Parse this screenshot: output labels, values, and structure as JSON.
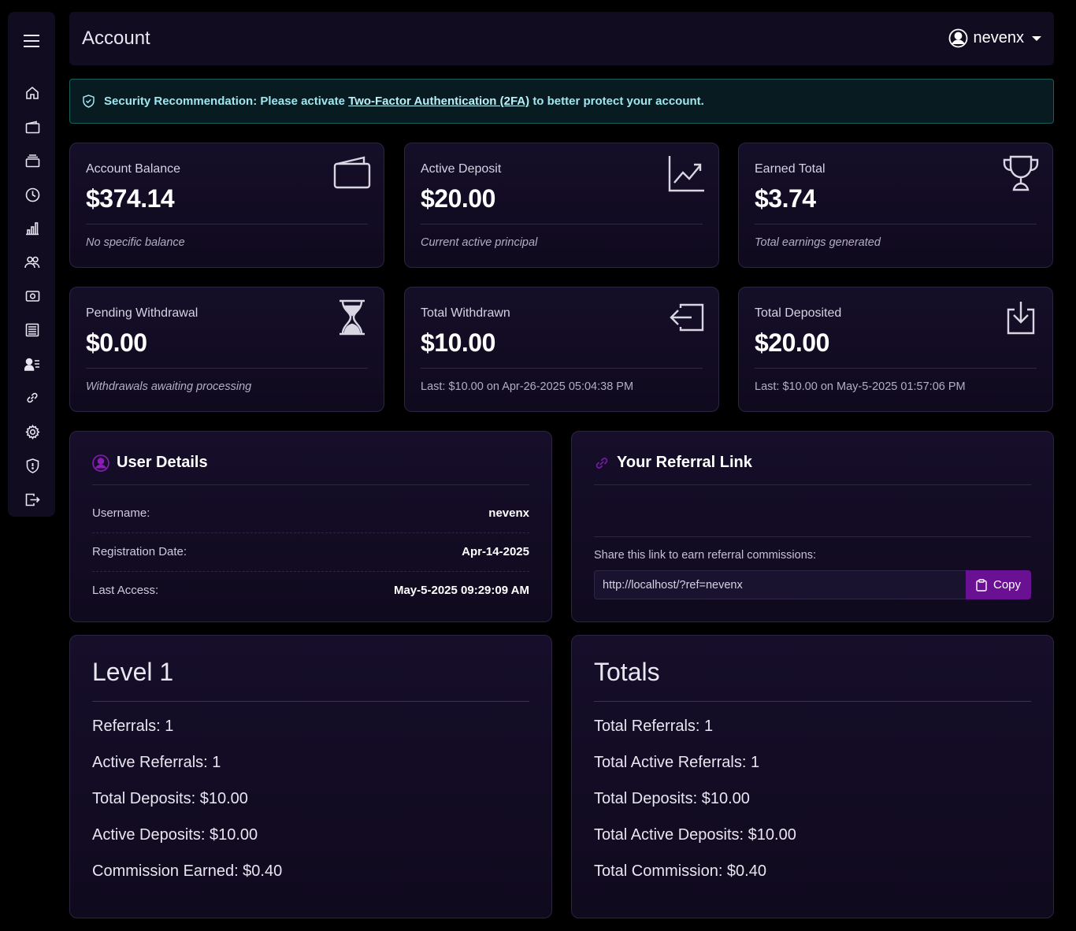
{
  "header": {
    "title": "Account",
    "username": "nevenx"
  },
  "alert": {
    "prefix": "Security Recommendation: Please activate",
    "link": "Two-Factor Authentication (2FA)",
    "suffix": "to better protect your account."
  },
  "stats": [
    {
      "label": "Account Balance",
      "value": "$374.14",
      "note": "No specific balance"
    },
    {
      "label": "Active Deposit",
      "value": "$20.00",
      "note": "Current active principal"
    },
    {
      "label": "Earned Total",
      "value": "$3.74",
      "note": "Total earnings generated"
    },
    {
      "label": "Pending Withdrawal",
      "value": "$0.00",
      "note": "Withdrawals awaiting processing"
    },
    {
      "label": "Total Withdrawn",
      "value": "$10.00",
      "note": "Last: $10.00 on Apr-26-2025 05:04:38 PM"
    },
    {
      "label": "Total Deposited",
      "value": "$20.00",
      "note": "Last: $10.00 on May-5-2025 01:57:06 PM"
    }
  ],
  "user_details": {
    "title": "User Details",
    "rows": [
      {
        "key": "Username:",
        "value": "nevenx"
      },
      {
        "key": "Registration Date:",
        "value": "Apr-14-2025"
      },
      {
        "key": "Last Access:",
        "value": "May-5-2025 09:29:09 AM"
      }
    ]
  },
  "referral": {
    "title": "Your Referral Link",
    "hint": "Share this link to earn referral commissions:",
    "link_value": "http://localhost/?ref=nevenx",
    "copy_label": "Copy"
  },
  "level1": {
    "title": "Level 1",
    "items": [
      "Referrals: 1",
      "Active Referrals: 1",
      "Total Deposits: $10.00",
      "Active Deposits: $10.00",
      "Commission Earned: $0.40"
    ]
  },
  "totals": {
    "title": "Totals",
    "items": [
      "Total Referrals: 1",
      "Total Active Referrals: 1",
      "Total Deposits: $10.00",
      "Total Active Deposits: $10.00",
      "Total Commission: $0.40"
    ]
  },
  "colors": {
    "background": "#000000",
    "card": "#120c21",
    "accent": "#6a1092",
    "alert_text": "#9fe6f0"
  },
  "icons": {
    "sidebar": [
      "menu-icon",
      "home-icon",
      "wallet-icon",
      "stack-icon",
      "clock-icon",
      "chart-icon",
      "users-icon",
      "cash-icon",
      "ledger-icon",
      "user-list-icon",
      "link-icon",
      "gear-icon",
      "shield-icon",
      "logout-icon"
    ],
    "cards": [
      "wallet-icon",
      "graph-up-icon",
      "trophy-icon",
      "hourglass-icon",
      "box-arrow-left-icon",
      "box-arrow-down-icon"
    ]
  }
}
